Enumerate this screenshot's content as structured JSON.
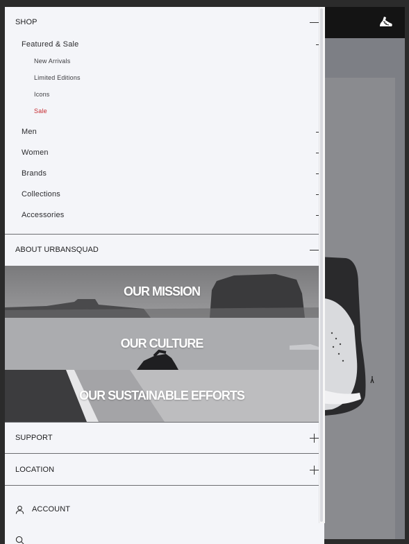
{
  "menu": {
    "shop": {
      "label": "SHOP",
      "featured": {
        "label": "Featured & Sale",
        "items": [
          "New Arrivals",
          "Limited Editions",
          "Icons",
          "Sale"
        ]
      },
      "categories": [
        "Men",
        "Women",
        "Brands",
        "Collections",
        "Accessories"
      ]
    },
    "about": {
      "label": "ABOUT URBANSQUAD",
      "banners": [
        "OUR MISSION",
        "OUR CULTURE",
        "OUR SUSTAINABLE EFFORTS"
      ]
    },
    "support": {
      "label": "SUPPORT"
    },
    "location": {
      "label": "LOCATION"
    },
    "account": {
      "label": "ACCOUNT"
    }
  },
  "colors": {
    "accent_sale": "#c62a2f",
    "drawer_bg": "#f4f5f9",
    "header_bg": "#141414"
  },
  "icons": {
    "expand": "plus-icon",
    "collapse": "minus-icon",
    "account": "user-icon",
    "logo": "sneaker-icon"
  }
}
